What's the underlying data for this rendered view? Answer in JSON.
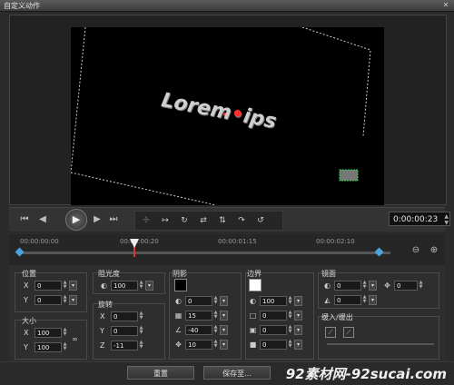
{
  "window": {
    "title": "自定义动作",
    "close_glyph": "✕"
  },
  "preview": {
    "text_prefix": "Lorem",
    "text_suffix": "ips",
    "dot": "•"
  },
  "transport": {
    "icons": [
      "go-start-icon",
      "prev-frame-icon",
      "play-icon",
      "next-frame-icon",
      "go-end-icon"
    ],
    "glyphs": [
      "⏮",
      "◀",
      "▶",
      "▶",
      "⏭"
    ],
    "play": "▶",
    "timecode": "0:00:00:23"
  },
  "tools": [
    "✢",
    "↦",
    "↻",
    "⇄",
    "⇅",
    "↷",
    "↺"
  ],
  "timeline": {
    "ticks": [
      "00:00:00:00",
      "00:00:00:20",
      "00:00:01:15",
      "00:00:02:10"
    ],
    "zoom_out": "⊖",
    "zoom_in": "⊕"
  },
  "position": {
    "title": "位置",
    "x_label": "X",
    "x": "0",
    "y_label": "Y",
    "y": "0"
  },
  "size": {
    "title": "大小",
    "x_label": "X",
    "x": "100",
    "y_label": "Y",
    "y": "100",
    "link": "∞"
  },
  "opacity": {
    "title": "阻光度",
    "value": "100"
  },
  "rotation": {
    "title": "旋转",
    "x_label": "X",
    "x": "0",
    "y_label": "Y",
    "y": "0",
    "z_label": "Z",
    "z": "-11"
  },
  "shadow": {
    "title": "阴影",
    "color": "#000000",
    "opacity": "0",
    "blur": "15",
    "angle": "-40",
    "distance": "10"
  },
  "border": {
    "title": "边界",
    "color": "#ffffff",
    "opacity": "100",
    "width": "0",
    "blur": "0",
    "other": "0"
  },
  "mirror": {
    "title": "镜面",
    "a": "0",
    "b": "0",
    "c": "0"
  },
  "fade": {
    "title": "缓入/缓出"
  },
  "buttons": {
    "reset": "重置",
    "save": "保存至..."
  },
  "watermark": "92素材网-92sucai.com"
}
